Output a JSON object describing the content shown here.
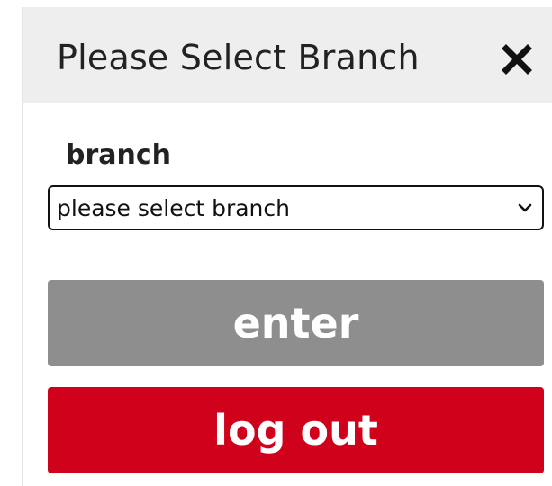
{
  "modal": {
    "title": "Please Select Branch",
    "close_icon": "close-icon"
  },
  "form": {
    "branch_label": "branch",
    "branch_select_value": "please select branch",
    "dropdown_icon": "chevron-down-icon"
  },
  "actions": {
    "enter_label": "enter",
    "logout_label": "log out"
  },
  "colors": {
    "header_bg": "#eeeeee",
    "enter_bg": "#8e8e8e",
    "logout_bg": "#d0021b"
  }
}
